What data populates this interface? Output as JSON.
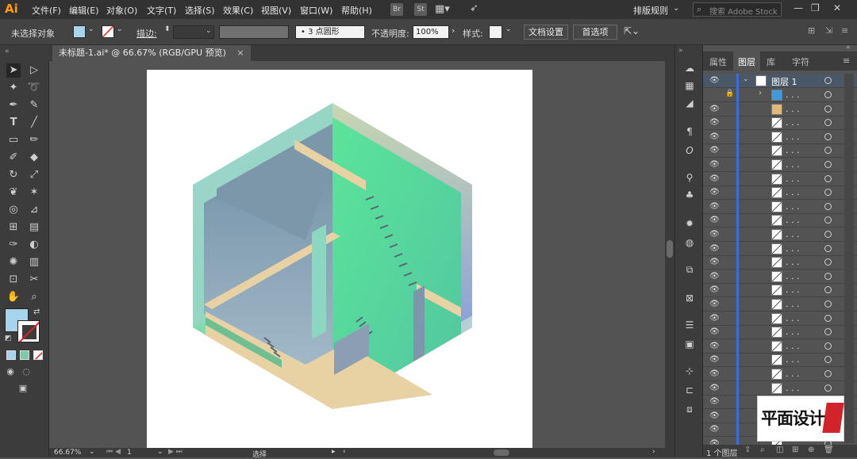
{
  "app": {
    "logo": "Ai"
  },
  "menu": [
    "文件(F)",
    "编辑(E)",
    "对象(O)",
    "文字(T)",
    "选择(S)",
    "效果(C)",
    "视图(V)",
    "窗口(W)",
    "帮助(H)"
  ],
  "menu_extra": {
    "br_badge": "Br",
    "st_badge": "St",
    "workspace": "排版规则",
    "search_placeholder": "搜索 Adobe Stock"
  },
  "control": {
    "no_selection": "未选择对象",
    "stroke_label": "描边:",
    "brush": "3 点圆形",
    "opacity_label": "不透明度:",
    "opacity_value": "100%",
    "style_label": "样式:",
    "doc_setup": "文档设置",
    "prefs": "首选项"
  },
  "doc_tab": {
    "title": "未标题-1.ai* @ 66.67% (RGB/GPU 预览)",
    "close": "×"
  },
  "status": {
    "zoom": "66.67%",
    "page": "1",
    "tool": "选择"
  },
  "layers_panel": {
    "tabs": [
      "属性",
      "图层",
      "库",
      "字符"
    ],
    "active_tab": "图层",
    "top_layer": "图层 1",
    "footer": "1 个图层",
    "row_dots": ". . ."
  },
  "watermark": "平面设计派",
  "colors": {
    "accent_blue": "#3b6dd8",
    "fill_swatch": "#a7d4ec",
    "logo": "#ff9a00"
  }
}
